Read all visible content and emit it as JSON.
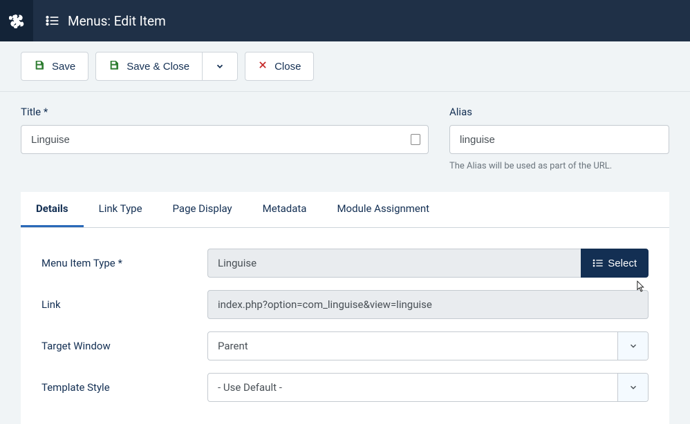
{
  "header": {
    "title": "Menus: Edit Item"
  },
  "toolbar": {
    "save": "Save",
    "save_close": "Save & Close",
    "close": "Close"
  },
  "fields": {
    "title_label": "Title *",
    "title_value": "Linguise",
    "alias_label": "Alias",
    "alias_value": "linguise",
    "alias_help": "The Alias will be used as part of the URL."
  },
  "tabs": [
    {
      "label": "Details",
      "active": true
    },
    {
      "label": "Link Type",
      "active": false
    },
    {
      "label": "Page Display",
      "active": false
    },
    {
      "label": "Metadata",
      "active": false
    },
    {
      "label": "Module Assignment",
      "active": false
    }
  ],
  "details": {
    "menu_item_type_label": "Menu Item Type *",
    "menu_item_type_value": "Linguise",
    "select_button": "Select",
    "link_label": "Link",
    "link_value": "index.php?option=com_linguise&view=linguise",
    "target_window_label": "Target Window",
    "target_window_value": "Parent",
    "template_style_label": "Template Style",
    "template_style_value": "- Use Default -"
  }
}
